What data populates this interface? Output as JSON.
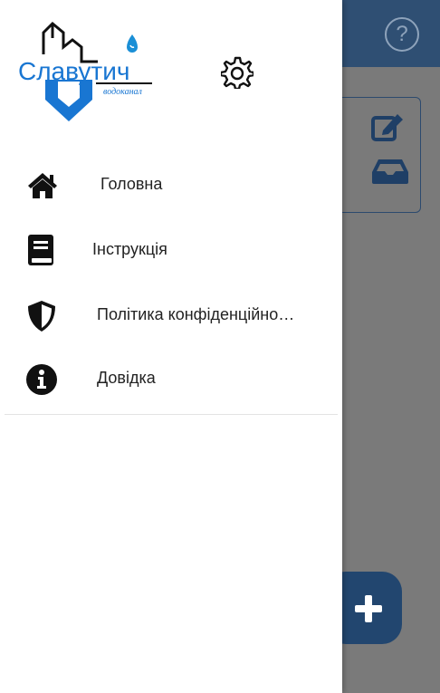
{
  "app": {
    "help_symbol": "?",
    "colors": {
      "header": "#2f4f73",
      "overlay": "#7a7a7a",
      "accent": "#22466f"
    },
    "fab_icon": "plus-icon",
    "card_icons": [
      "edit-icon",
      "inbox-icon"
    ]
  },
  "drawer": {
    "logo": {
      "name": "Славутич",
      "tagline": "водоканал"
    },
    "settings_icon": "gear-icon",
    "menu": [
      {
        "label": "Головна",
        "icon": "home-icon"
      },
      {
        "label": "Інструкція",
        "icon": "book-icon"
      },
      {
        "label": "Політика конфіденційно…",
        "icon": "shield-icon"
      },
      {
        "label": "Довідка",
        "icon": "info-icon"
      }
    ]
  }
}
